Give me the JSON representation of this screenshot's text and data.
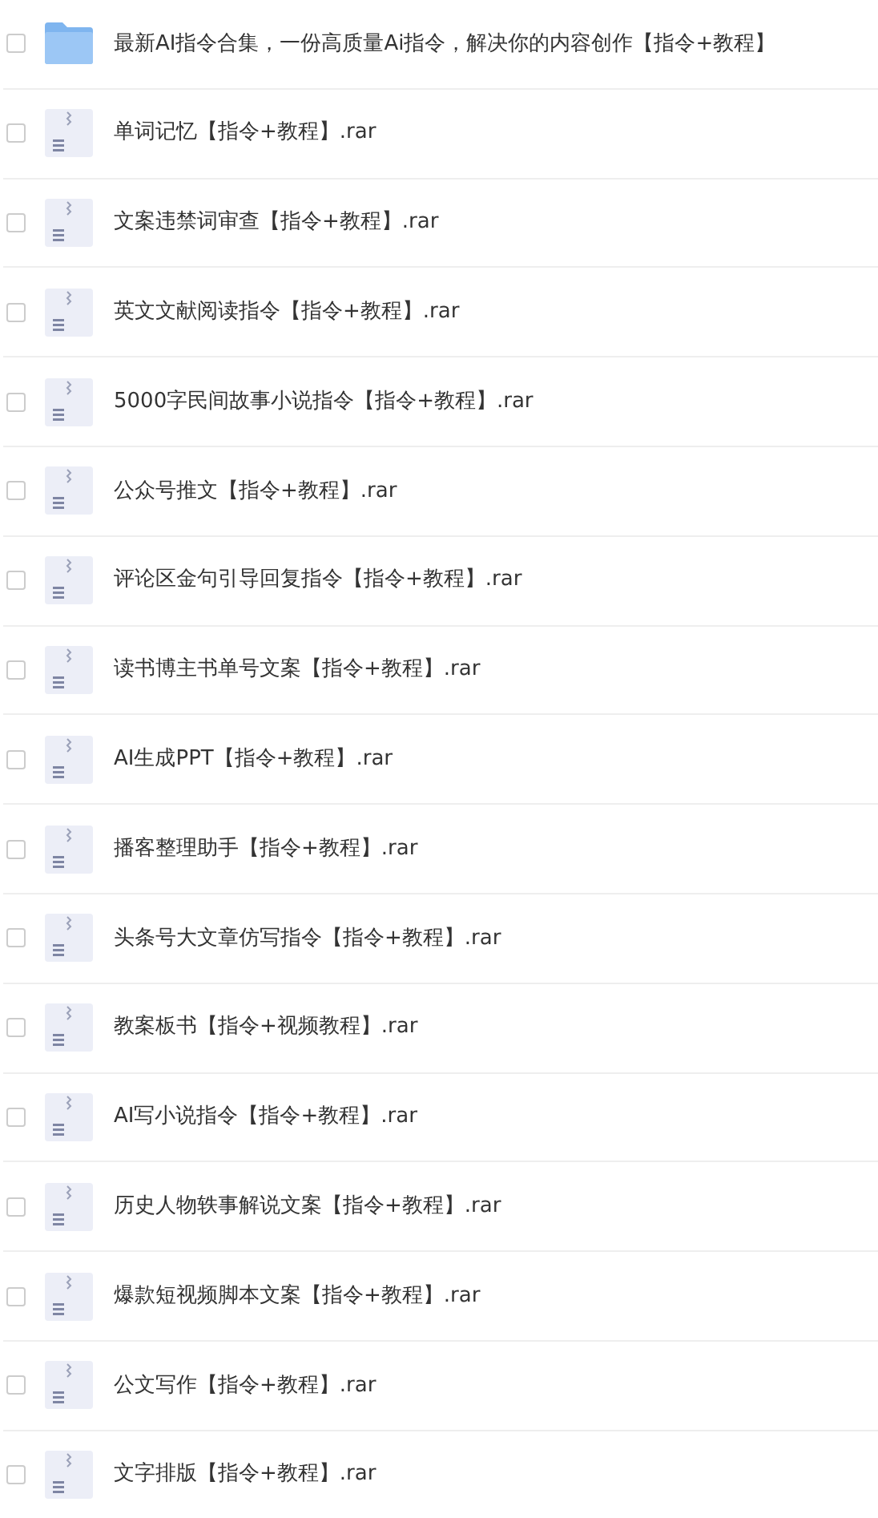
{
  "files": [
    {
      "kind": "folder",
      "name": "最新AI指令合集，一份高质量Ai指令，解决你的内容创作【指令+教程】",
      "checked": false
    },
    {
      "kind": "archive",
      "name": "单词记忆【指令+教程】.rar",
      "checked": false
    },
    {
      "kind": "archive",
      "name": "文案违禁词审查【指令+教程】.rar",
      "checked": false
    },
    {
      "kind": "archive",
      "name": "英文文献阅读指令【指令+教程】.rar",
      "checked": false
    },
    {
      "kind": "archive",
      "name": "5000字民间故事小说指令【指令+教程】.rar",
      "checked": false
    },
    {
      "kind": "archive",
      "name": "公众号推文【指令+教程】.rar",
      "checked": false
    },
    {
      "kind": "archive",
      "name": "评论区金句引导回复指令【指令+教程】.rar",
      "checked": false
    },
    {
      "kind": "archive",
      "name": "读书博主书单号文案【指令+教程】.rar",
      "checked": false
    },
    {
      "kind": "archive",
      "name": "AI生成PPT【指令+教程】.rar",
      "checked": false
    },
    {
      "kind": "archive",
      "name": "播客整理助手【指令+教程】.rar",
      "checked": false
    },
    {
      "kind": "archive",
      "name": "头条号大文章仿写指令【指令+教程】.rar",
      "checked": false
    },
    {
      "kind": "archive",
      "name": "教案板书【指令+视频教程】.rar",
      "checked": false
    },
    {
      "kind": "archive",
      "name": "AI写小说指令【指令+教程】.rar",
      "checked": false
    },
    {
      "kind": "archive",
      "name": "历史人物轶事解说文案【指令+教程】.rar",
      "checked": false
    },
    {
      "kind": "archive",
      "name": "爆款短视频脚本文案【指令+教程】.rar",
      "checked": false
    },
    {
      "kind": "archive",
      "name": "公文写作【指令+教程】.rar",
      "checked": false
    },
    {
      "kind": "archive",
      "name": "文字排版【指令+教程】.rar",
      "checked": false
    }
  ]
}
